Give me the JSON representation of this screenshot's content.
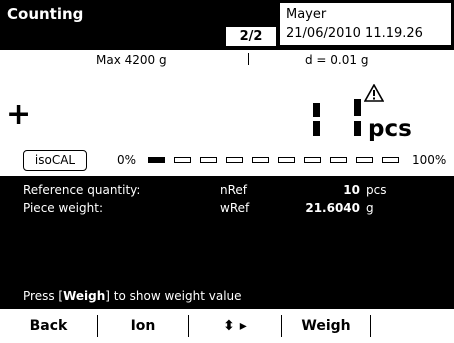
{
  "header": {
    "title": "Counting",
    "page_indicator": "2/2",
    "user": "Mayer",
    "datetime": "21/06/2010 11.19.26"
  },
  "scale": {
    "max_label": "Max 4200 g",
    "d_label": "d = 0.01 g",
    "sign": "+",
    "unit": "pcs",
    "warning_icon": "warning-triangle-icon",
    "display_state": "segment-digits-partial"
  },
  "calibration": {
    "button_label": "isoCAL"
  },
  "progress": {
    "start_label": "0%",
    "end_label": "100%",
    "level": 0.1
  },
  "info": {
    "rows": [
      {
        "label": "Reference quantity:",
        "code": "nRef",
        "value": "10",
        "unit": "pcs"
      },
      {
        "label": "Piece weight:",
        "code": "wRef",
        "value": "21.6040",
        "unit": "g"
      }
    ],
    "hint_prefix": "Press [",
    "hint_key": "Weigh",
    "hint_suffix": "] to show weight value"
  },
  "softkeys": [
    {
      "label": "Back"
    },
    {
      "label": "Ion"
    },
    {
      "label": "⬍ ▸"
    },
    {
      "label": "Weigh"
    },
    {
      "label": ""
    }
  ]
}
